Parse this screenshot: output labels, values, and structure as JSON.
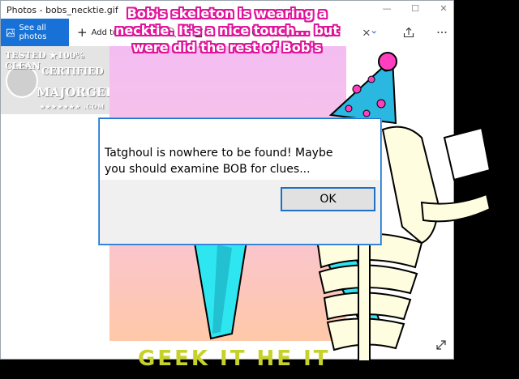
{
  "window": {
    "title": "Photos - bobs_necktie.gif",
    "controls": [
      "minimize-icon",
      "maximize-icon",
      "close-icon"
    ]
  },
  "toolbar": {
    "see_all_label": "See all photos",
    "add_to_label": "Add to",
    "icons": [
      "zoom-icon",
      "delete-icon",
      "favorite-icon",
      "rotate-icon",
      "crop-icon",
      "enhance-icon",
      "edit-draw-icon",
      "share-icon",
      "more-icon"
    ]
  },
  "image": {
    "watermark": {
      "line1": "TESTED ★100% CLEAN",
      "line2": "CERTIFIED",
      "line3": "MAJORGEEKS",
      "line4": "★★★★★★★ .COM"
    },
    "caption": "Bob's skeleton is wearing a\nnecktie. It's a nice touch... but\nwere did the rest of Bob's",
    "bottom_text": "GEEK IT HE IT"
  },
  "dialog": {
    "message": "Tatghoul is nowhere to be found! Maybe\nyou should examine BOB for clues...",
    "ok_label": "OK"
  },
  "colors": {
    "accent": "#1771d6",
    "caption_outline": "#e0149a",
    "tie": "#2ee6f0",
    "hat": "#2ab8e0",
    "hat_dots": "#ff3fbf",
    "bottom_text": "#c6d12a"
  }
}
